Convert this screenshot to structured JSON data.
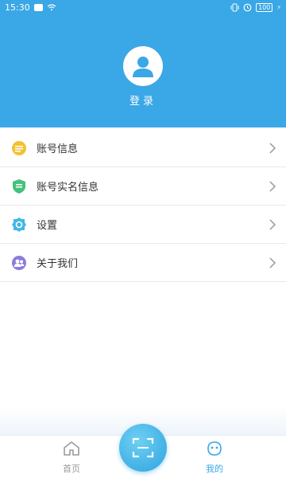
{
  "status_bar": {
    "time": "15:30",
    "battery": "100"
  },
  "profile": {
    "login_label": "登录"
  },
  "menu": [
    {
      "label": "账号信息",
      "icon": "account-info-icon",
      "color": "#f1c232"
    },
    {
      "label": "账号实名信息",
      "icon": "shield-icon",
      "color": "#44c27a"
    },
    {
      "label": "设置",
      "icon": "gear-icon",
      "color": "#41b8e8"
    },
    {
      "label": "关于我们",
      "icon": "users-icon",
      "color": "#8c7be0"
    }
  ],
  "tabs": {
    "home": "首页",
    "mine": "我的"
  },
  "colors": {
    "primary": "#3aa7e6",
    "background": "#ffffff"
  }
}
